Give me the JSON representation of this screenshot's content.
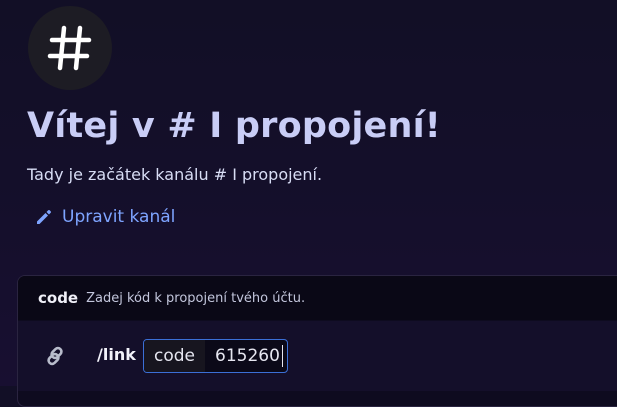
{
  "channel": {
    "icon": "hash-icon",
    "welcome_title": "Vítej v # I propojení!",
    "subtitle": "Tady je začátek kanálu # I propojení.",
    "edit_label": "Upravit kanál"
  },
  "command": {
    "name": "code",
    "description": "Zadej kód k propojení tvého účtu.",
    "slash": "/link",
    "option_name": "code",
    "option_value": "615260"
  },
  "colors": {
    "accent": "#7ea4ff",
    "title": "#c9cdf6",
    "input_border": "#3b6fd6"
  }
}
